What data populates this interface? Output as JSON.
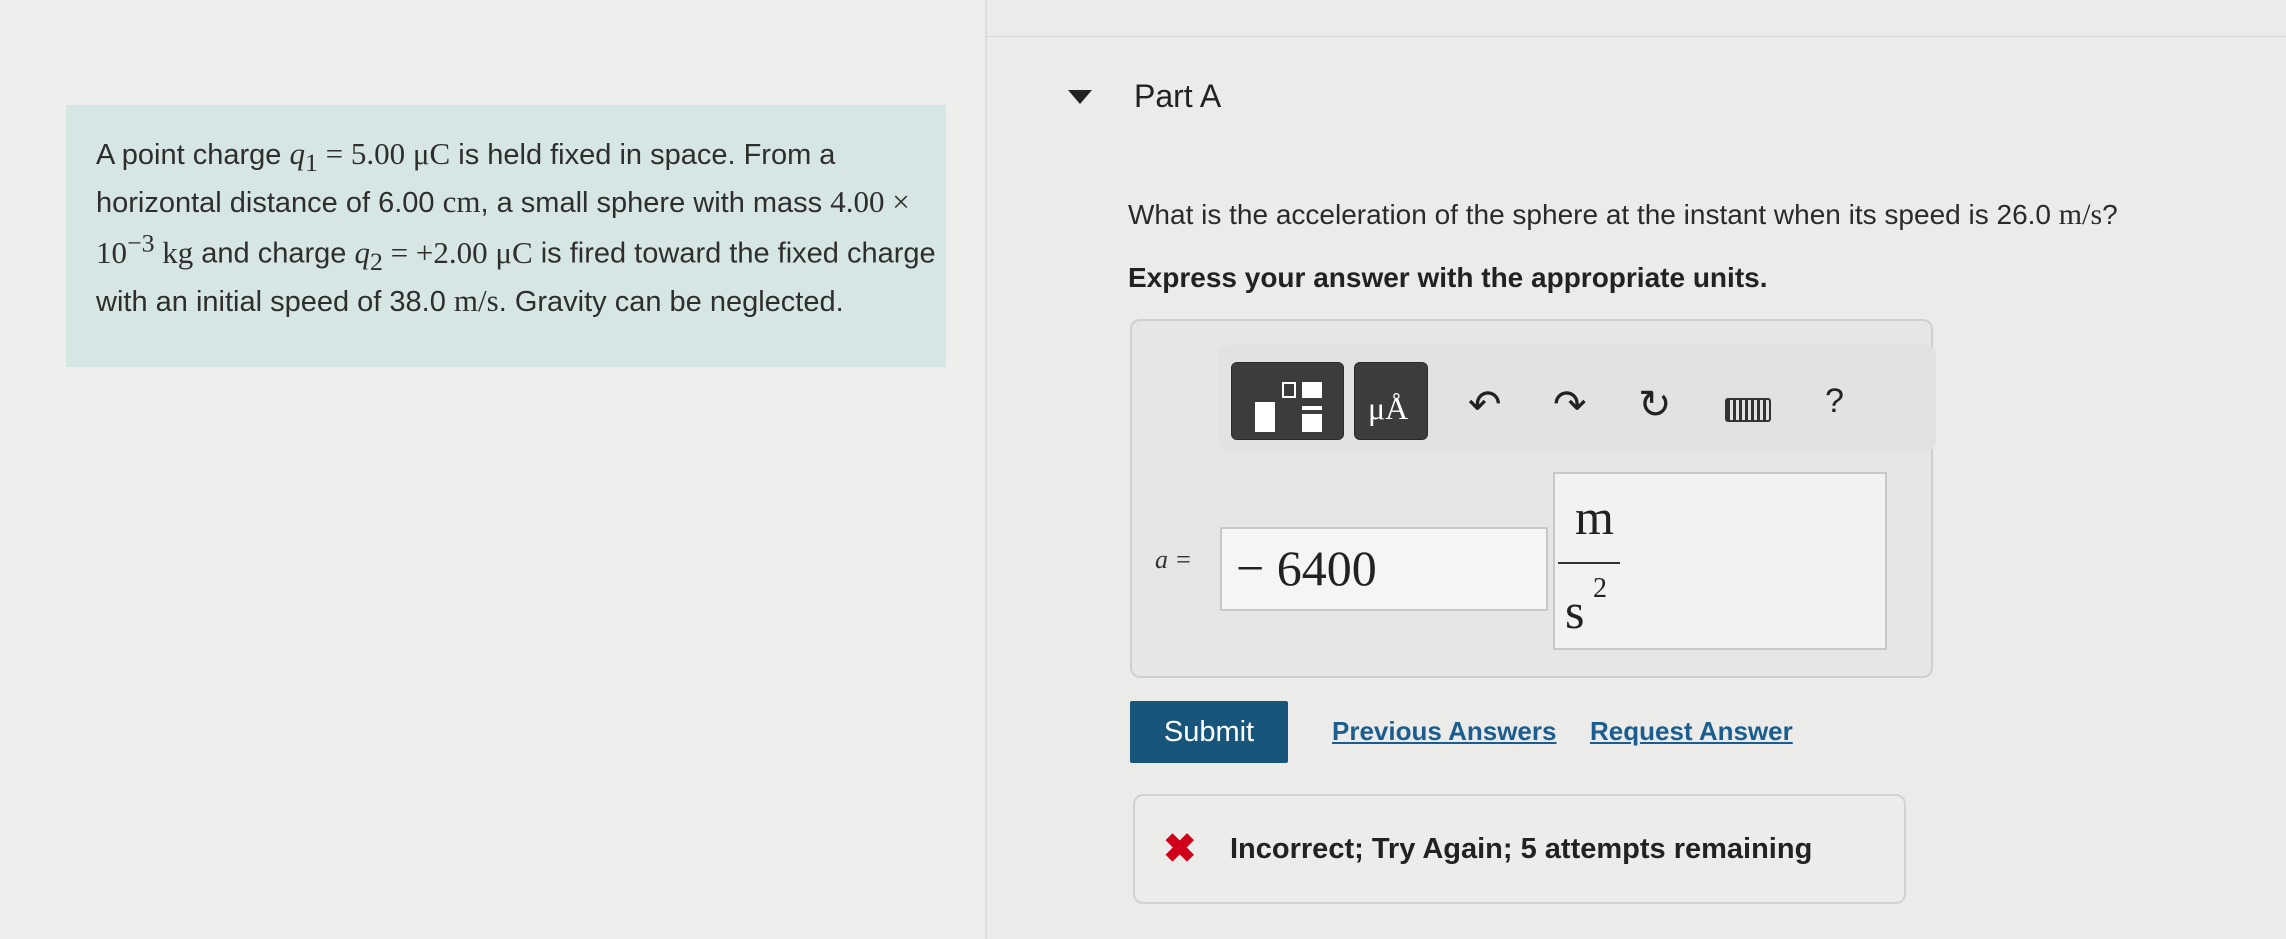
{
  "problem": {
    "text_1": "A point charge ",
    "q1": "q",
    "q1_sub": "1",
    "q1_eq": " = 5.00 ",
    "mu_c1": "μC",
    "text_2": " is held fixed in space. From a horizontal distance of 6.00 ",
    "cm": "cm",
    "text_3": ", a small sphere with mass ",
    "mass_mant": "4.00 × 10",
    "mass_exp": "−3",
    "mass_unit": " kg",
    "text_4": " and charge ",
    "q2": "q",
    "q2_sub": "2",
    "q2_eq": " = +2.00 ",
    "mu_c2": "μC",
    "text_5": " is fired toward the fixed charge with an initial speed of 38.0 ",
    "speed_unit": "m/s",
    "text_6": ". Gravity can be neglected."
  },
  "part": {
    "title": "Part A",
    "question_pre": "What is the acceleration of the sphere at the instant when its speed is 26.0 ",
    "question_unit": "m/s",
    "question_post": "?",
    "instruction": "Express your answer with the appropriate units."
  },
  "toolbar": {
    "units_glyph": "μÅ",
    "undo_icon": "↶",
    "redo_icon": "↷",
    "reset_icon": "↻",
    "help": "?"
  },
  "answer": {
    "label": "a =",
    "value": "− 6400",
    "unit_numerator": "m",
    "unit_denominator": "s",
    "unit_exponent": "2"
  },
  "actions": {
    "submit": "Submit",
    "previous_answers": "Previous Answers",
    "request_answer": "Request Answer"
  },
  "feedback": {
    "icon": "✖",
    "message": "Incorrect; Try Again; 5 attempts remaining"
  },
  "colors": {
    "problem_bg": "#d6e6e4",
    "submit_bg": "#17567a",
    "link": "#1b5d8f",
    "error": "#d0021b"
  }
}
